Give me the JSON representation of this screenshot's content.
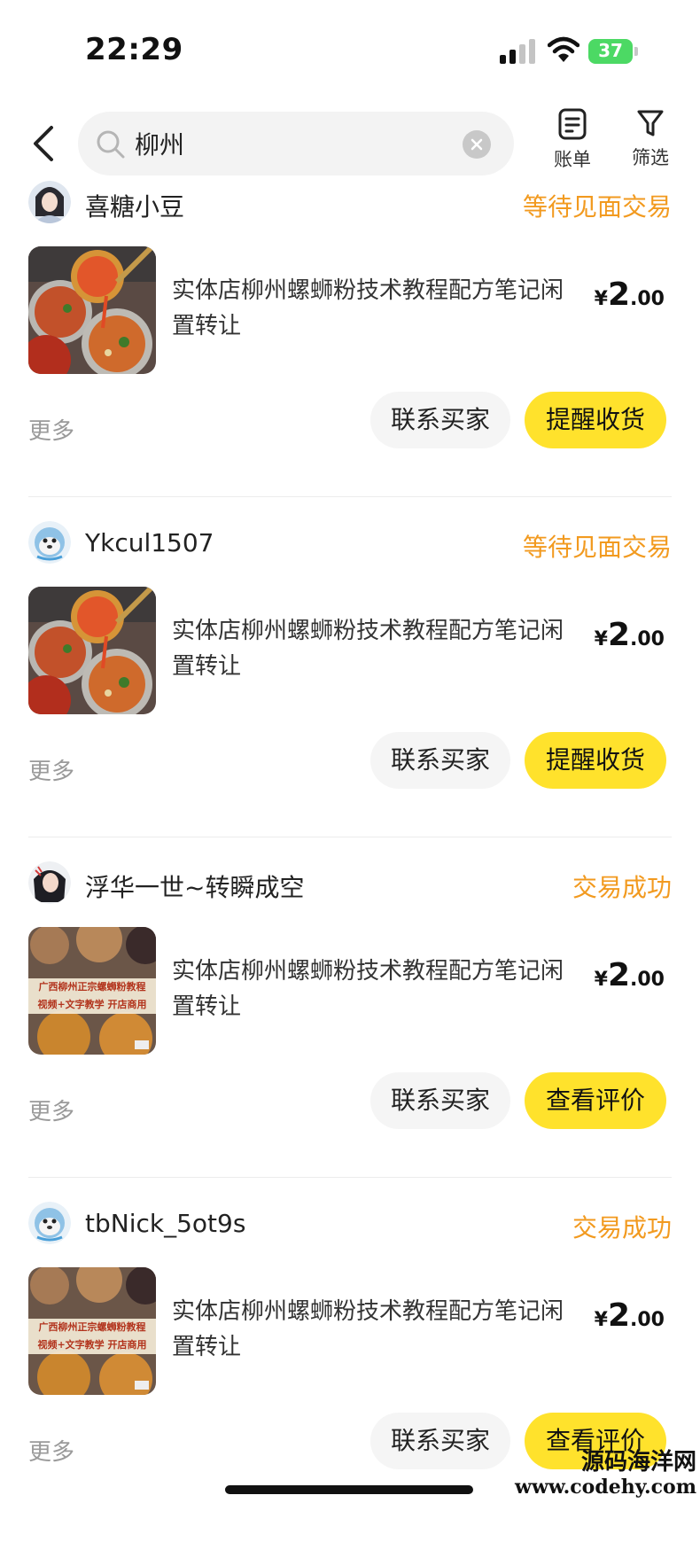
{
  "status_bar": {
    "time": "22:29",
    "battery": "37"
  },
  "header": {
    "search_value": "柳州",
    "bill_label": "账单",
    "filter_label": "筛选"
  },
  "orders": [
    {
      "seller": "喜糖小豆",
      "status": "等待见面交易",
      "title": "实体店柳州螺蛳粉技术教程配方笔记闲置转让",
      "price_currency": "¥",
      "price_int": "2",
      "price_dec": ".00",
      "more": "更多",
      "contact_label": "联系买家",
      "action_label": "提醒收货"
    },
    {
      "seller": "Ykcul1507",
      "status": "等待见面交易",
      "title": "实体店柳州螺蛳粉技术教程配方笔记闲置转让",
      "price_currency": "¥",
      "price_int": "2",
      "price_dec": ".00",
      "more": "更多",
      "contact_label": "联系买家",
      "action_label": "提醒收货"
    },
    {
      "seller": "浮华一世~转瞬成空",
      "status": "交易成功",
      "title": "实体店柳州螺蛳粉技术教程配方笔记闲置转让",
      "price_currency": "¥",
      "price_int": "2",
      "price_dec": ".00",
      "more": "更多",
      "contact_label": "联系买家",
      "action_label": "查看评价",
      "thumb_caption_1": "广西柳州正宗螺蛳粉教程",
      "thumb_caption_2": "视频+文字教学 开店商用"
    },
    {
      "seller": "tbNick_5ot9s",
      "status": "交易成功",
      "title": "实体店柳州螺蛳粉技术教程配方笔记闲置转让",
      "price_currency": "¥",
      "price_int": "2",
      "price_dec": ".00",
      "more": "更多",
      "contact_label": "联系买家",
      "action_label": "查看评价",
      "thumb_caption_1": "广西柳州正宗螺蛳粉教程",
      "thumb_caption_2": "视频+文字教学 开店商用"
    }
  ],
  "watermark": {
    "line1": "源码海洋网",
    "line2": "www.codehy.com"
  },
  "colors": {
    "status_orange": "#f29a1f",
    "accent_yellow": "#ffe22c"
  }
}
